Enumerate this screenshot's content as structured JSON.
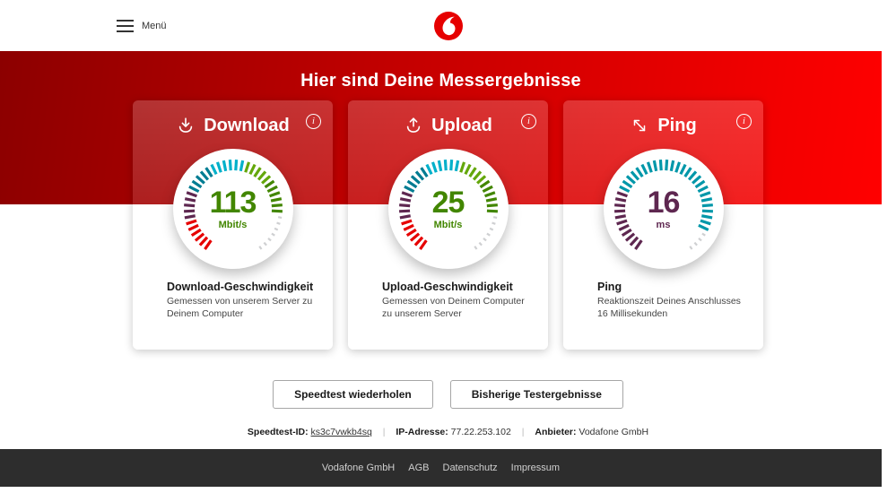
{
  "header": {
    "menu_label": "Menü"
  },
  "hero": {
    "title": "Hier sind Deine Messergebnisse"
  },
  "cards": [
    {
      "title": "Download",
      "icon": "download-icon",
      "gauge": {
        "value": "113",
        "unit": "Mbit/s",
        "value_color": "#428600",
        "segments": [
          {
            "color": "#e60000",
            "count": 6
          },
          {
            "color": "#5e2750",
            "count": 5
          },
          {
            "color": "#007c92",
            "count": 5
          },
          {
            "color": "#00b0ca",
            "count": 6
          },
          {
            "color": "#64a70b",
            "count": 5
          },
          {
            "color": "#428600",
            "count": 6
          }
        ],
        "rest_color": "#cfd0d2",
        "rest_count": 7
      },
      "subtitle": "Download-Geschwindigkeit",
      "description": "Gemessen von unserem Server zu Deinem Computer"
    },
    {
      "title": "Upload",
      "icon": "upload-icon",
      "gauge": {
        "value": "25",
        "unit": "Mbit/s",
        "value_color": "#428600",
        "segments": [
          {
            "color": "#e60000",
            "count": 6
          },
          {
            "color": "#5e2750",
            "count": 5
          },
          {
            "color": "#007c92",
            "count": 5
          },
          {
            "color": "#00b0ca",
            "count": 6
          },
          {
            "color": "#64a70b",
            "count": 5
          },
          {
            "color": "#428600",
            "count": 6
          }
        ],
        "rest_color": "#cfd0d2",
        "rest_count": 7
      },
      "subtitle": "Upload-Geschwindigkeit",
      "description": "Gemessen von Deinem Computer zu unserem Server"
    },
    {
      "title": "Ping",
      "icon": "ping-icon",
      "gauge": {
        "value": "16",
        "unit": "ms",
        "value_color": "#5e2750",
        "segments": [
          {
            "color": "#5e2750",
            "count": 11
          },
          {
            "color": "#0097a9",
            "count": 25
          }
        ],
        "rest_color": "#cfd0d2",
        "rest_count": 4
      },
      "subtitle": "Ping",
      "description": "Reaktionszeit Deines Anschlusses 16 Millisekunden"
    }
  ],
  "info_icon_glyph": "i",
  "actions": [
    {
      "label": "Speedtest wiederholen"
    },
    {
      "label": "Bisherige Testergebnisse"
    }
  ],
  "meta": {
    "id_label": "Speedtest-ID:",
    "id_value": "ks3c7vwkb4sq",
    "separator": "|",
    "ip_label": "IP-Adresse:",
    "ip_value": "77.22.253.102",
    "provider_label": "Anbieter:",
    "provider_value": "Vodafone GmbH"
  },
  "footer": {
    "links": [
      "Vodafone GmbH",
      "AGB",
      "Datenschutz",
      "Impressum"
    ]
  },
  "colors": {
    "brand_red": "#e60000",
    "hero_gradient_start": "#8c0000",
    "hero_gradient_end": "#ff0000",
    "footer_bg": "#2d2d2d",
    "download_value": "#428600",
    "ping_value": "#5e2750"
  }
}
